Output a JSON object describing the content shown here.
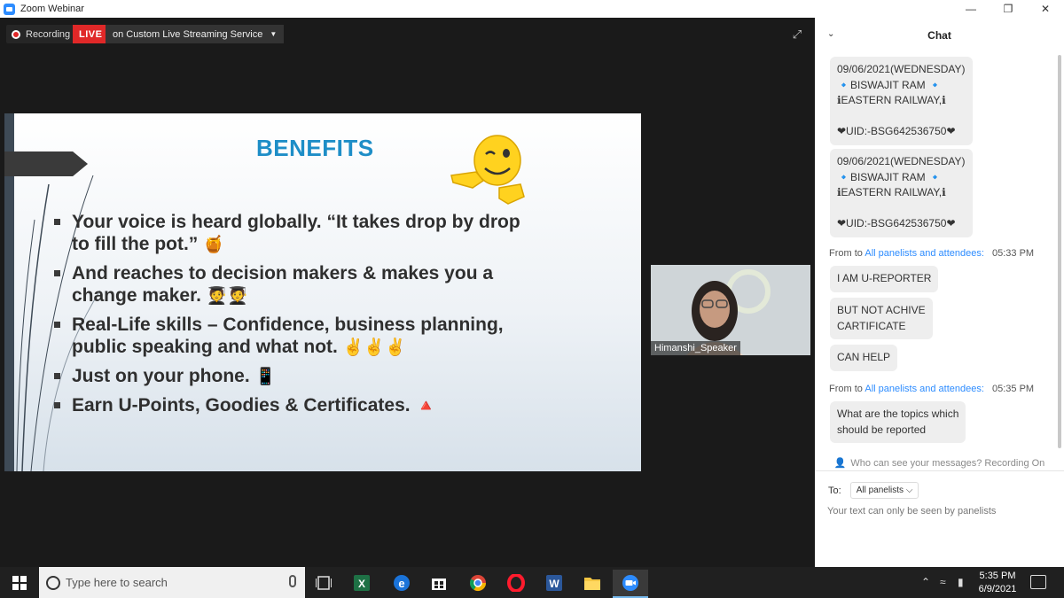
{
  "window": {
    "title": "Zoom Webinar"
  },
  "meeting": {
    "recording_label": "Recording",
    "live_label": "LIVE",
    "stream_label": "on Custom Live Streaming Service"
  },
  "slide": {
    "title": "BENEFITS",
    "bullets": [
      {
        "lines": [
          "Your voice is heard globally. “It takes drop by drop",
          "to fill the pot.”"
        ],
        "emoji": "🍯"
      },
      {
        "lines": [
          "And reaches to decision makers & makes you a",
          "change maker."
        ],
        "emoji": "🧑‍🎓🧑‍🎓"
      },
      {
        "lines": [
          "Real-Life skills – Confidence, business planning,",
          "public speaking and what not."
        ],
        "emoji": "✌️✌️✌️"
      },
      {
        "lines": [
          "Just on your phone."
        ],
        "emoji": "📱"
      },
      {
        "lines": [
          "Earn U-Points, Goodies & Certificates."
        ],
        "emoji": "🔺"
      }
    ]
  },
  "speaker": {
    "name": "Himanshi_Speaker"
  },
  "chat": {
    "title": "Chat",
    "messages": [
      {
        "lines": [
          "09/06/2021(WEDNESDAY)",
          "🔹BISWAJIT RAM 🔹",
          "ℹEASTERN RAILWAY,ℹ",
          "",
          "❤UID:-BSG642536750❤"
        ]
      },
      {
        "lines": [
          "09/06/2021(WEDNESDAY)",
          "🔹BISWAJIT RAM 🔹",
          "ℹEASTERN RAILWAY,ℹ",
          "",
          "❤UID:-BSG642536750❤"
        ]
      },
      {
        "from": "From",
        "to": "to",
        "audience": "All panelists and attendees:",
        "time": "05:33 PM"
      },
      {
        "lines": [
          "I AM U-REPORTER"
        ]
      },
      {
        "lines": [
          "BUT NOT ACHIVE",
          "CARTIFICATE"
        ]
      },
      {
        "lines": [
          "CAN HELP"
        ]
      },
      {
        "from": "From",
        "to": "to",
        "audience": "All panelists and attendees:",
        "time": "05:35 PM"
      },
      {
        "lines": [
          "What are the topics which",
          "should be reported"
        ]
      }
    ],
    "visibility_notice": "Who can see your messages? Recording On",
    "to_label": "To:",
    "to_value": "All panelists",
    "compose_placeholder": "Your text can only be seen by panelists"
  },
  "taskbar": {
    "search_placeholder": "Type here to search",
    "time": "5:35 PM",
    "date": "6/9/2021",
    "apps": [
      "task-view-icon",
      "excel-icon",
      "edge-icon",
      "store-icon",
      "chrome-icon",
      "opera-icon",
      "word-icon",
      "file-explorer-icon",
      "zoom-icon"
    ]
  },
  "colors": {
    "zoom_blue": "#2d8cff",
    "live_red": "#e02828",
    "slide_title": "#1e8ec7"
  }
}
